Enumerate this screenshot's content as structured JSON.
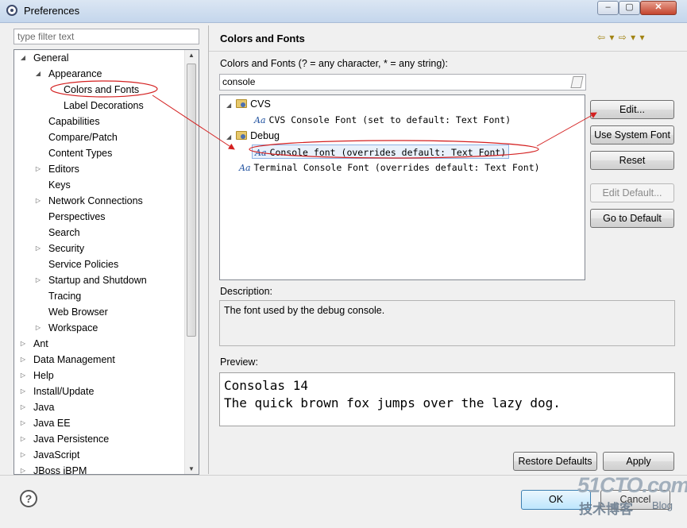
{
  "window": {
    "title": "Preferences",
    "min_glyph": "–",
    "max_glyph": "▢",
    "close_glyph": "✕"
  },
  "filter": {
    "placeholder": "type filter text"
  },
  "nav_tree": [
    {
      "label": "General",
      "level": 0,
      "twisty": "open"
    },
    {
      "label": "Appearance",
      "level": 1,
      "twisty": "open"
    },
    {
      "label": "Colors and Fonts",
      "level": 2,
      "twisty": "none",
      "selected": true
    },
    {
      "label": "Label Decorations",
      "level": 2,
      "twisty": "none"
    },
    {
      "label": "Capabilities",
      "level": 1,
      "twisty": "none"
    },
    {
      "label": "Compare/Patch",
      "level": 1,
      "twisty": "none"
    },
    {
      "label": "Content Types",
      "level": 1,
      "twisty": "none"
    },
    {
      "label": "Editors",
      "level": 1,
      "twisty": "closed"
    },
    {
      "label": "Keys",
      "level": 1,
      "twisty": "none"
    },
    {
      "label": "Network Connections",
      "level": 1,
      "twisty": "closed"
    },
    {
      "label": "Perspectives",
      "level": 1,
      "twisty": "none"
    },
    {
      "label": "Search",
      "level": 1,
      "twisty": "none"
    },
    {
      "label": "Security",
      "level": 1,
      "twisty": "closed"
    },
    {
      "label": "Service Policies",
      "level": 1,
      "twisty": "none"
    },
    {
      "label": "Startup and Shutdown",
      "level": 1,
      "twisty": "closed"
    },
    {
      "label": "Tracing",
      "level": 1,
      "twisty": "none"
    },
    {
      "label": "Web Browser",
      "level": 1,
      "twisty": "none"
    },
    {
      "label": "Workspace",
      "level": 1,
      "twisty": "closed"
    },
    {
      "label": "Ant",
      "level": 0,
      "twisty": "closed"
    },
    {
      "label": "Data Management",
      "level": 0,
      "twisty": "closed"
    },
    {
      "label": "Help",
      "level": 0,
      "twisty": "closed"
    },
    {
      "label": "Install/Update",
      "level": 0,
      "twisty": "closed"
    },
    {
      "label": "Java",
      "level": 0,
      "twisty": "closed"
    },
    {
      "label": "Java EE",
      "level": 0,
      "twisty": "closed"
    },
    {
      "label": "Java Persistence",
      "level": 0,
      "twisty": "closed"
    },
    {
      "label": "JavaScript",
      "level": 0,
      "twisty": "closed"
    },
    {
      "label": "JBoss jBPM",
      "level": 0,
      "twisty": "closed"
    }
  ],
  "page": {
    "title": "Colors and Fonts",
    "nav_icons": "⇦ ▾ ⇨ ▾ ▾",
    "search_label": "Colors and Fonts (? = any character, * = any string):",
    "search_value": "console"
  },
  "fonts_tree": [
    {
      "kind": "category",
      "label": "CVS",
      "level": 0
    },
    {
      "kind": "font",
      "label": "CVS Console Font (set to default: Text Font)",
      "level": 1
    },
    {
      "kind": "category",
      "label": "Debug",
      "level": 0
    },
    {
      "kind": "font",
      "label": "Console font (overrides default: Text Font)",
      "level": 1,
      "selected": true
    },
    {
      "kind": "font",
      "label": "Terminal Console Font (overrides default: Text Font)",
      "level": 0
    }
  ],
  "font_icon_text": "Aa",
  "buttons": {
    "edit": "Edit...",
    "use_system_font": "Use System Font",
    "reset": "Reset",
    "edit_default": "Edit Default...",
    "go_to_default": "Go to Default",
    "restore_defaults": "Restore Defaults",
    "apply": "Apply",
    "ok": "OK",
    "cancel": "Cancel"
  },
  "description": {
    "label": "Description:",
    "text": "The font used by the debug console."
  },
  "preview": {
    "label": "Preview:",
    "line1": "Consolas 14",
    "line2": "The quick brown fox jumps over the lazy dog."
  },
  "help_glyph": "?",
  "watermark": {
    "main": "51CTO.com",
    "sub": "技术博客",
    "blog": "Blog"
  },
  "annotation_color": "#d42020"
}
